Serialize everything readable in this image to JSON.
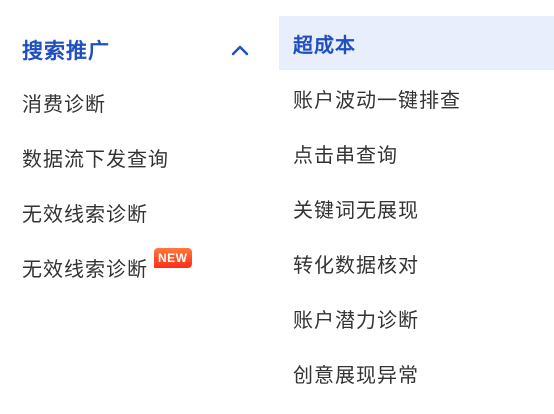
{
  "nav": {
    "section_title": "搜索推广",
    "left_items": [
      {
        "label": "消费诊断"
      },
      {
        "label": "数据流下发查询"
      },
      {
        "label": "无效线索诊断"
      },
      {
        "label": "无效线索诊断",
        "badge": "NEW"
      }
    ],
    "right_items": [
      {
        "label": "超成本",
        "active": true
      },
      {
        "label": "账户波动一键排查"
      },
      {
        "label": "点击串查询"
      },
      {
        "label": "关键词无展现"
      },
      {
        "label": "转化数据核对"
      },
      {
        "label": "账户潜力诊断"
      },
      {
        "label": "创意展现异常"
      }
    ]
  },
  "icons": {
    "section_toggle": "chevron-up-icon"
  },
  "colors": {
    "accent": "#1f4fbf",
    "active_bg": "#e8eefb",
    "text": "#333333",
    "badge": "#ff3b1f"
  }
}
